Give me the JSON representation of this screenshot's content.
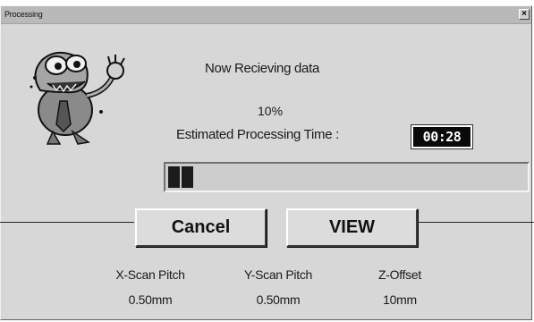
{
  "window": {
    "title": "Processing",
    "close_glyph": "×"
  },
  "status": {
    "message": "Now Recieving data",
    "percent": "10%",
    "estimated_label": "Estimated Processing Time :",
    "estimated_time": "00:28"
  },
  "progress": {
    "fraction": 0.1
  },
  "buttons": {
    "cancel_label": "Cancel",
    "view_label": "VIEW"
  },
  "params": [
    {
      "label": "X-Scan Pitch",
      "value": "0.50mm"
    },
    {
      "label": "Y-Scan Pitch",
      "value": "0.50mm"
    },
    {
      "label": "Z-Offset",
      "value": "10mm"
    }
  ],
  "icons": {
    "mascot": "cartoon-mascot-icon",
    "close": "close-icon"
  },
  "colors": {
    "dialog_bg": "#d7d7d7",
    "titlebar_bg": "#b9b9b9",
    "time_box_bg": "#0a0a0a",
    "progress_fill": "#1b1b1b"
  }
}
